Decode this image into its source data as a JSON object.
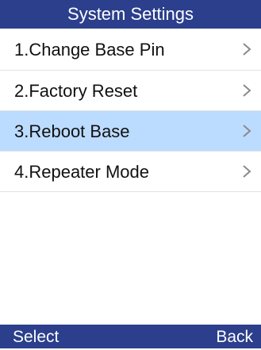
{
  "header": {
    "title": "System Settings"
  },
  "menu": {
    "items": [
      {
        "label": "1.Change Base Pin",
        "selected": false
      },
      {
        "label": "2.Factory Reset",
        "selected": false
      },
      {
        "label": "3.Reboot Base",
        "selected": true
      },
      {
        "label": "4.Repeater Mode",
        "selected": false
      }
    ],
    "chevron_icon": "chevron-right-icon"
  },
  "softkeys": {
    "left": "Select",
    "right": "Back"
  },
  "colors": {
    "header_bg": "#2b3f8c",
    "selected_bg": "#bcdcff",
    "text": "#111111",
    "chevron": "#8a8a8a"
  }
}
